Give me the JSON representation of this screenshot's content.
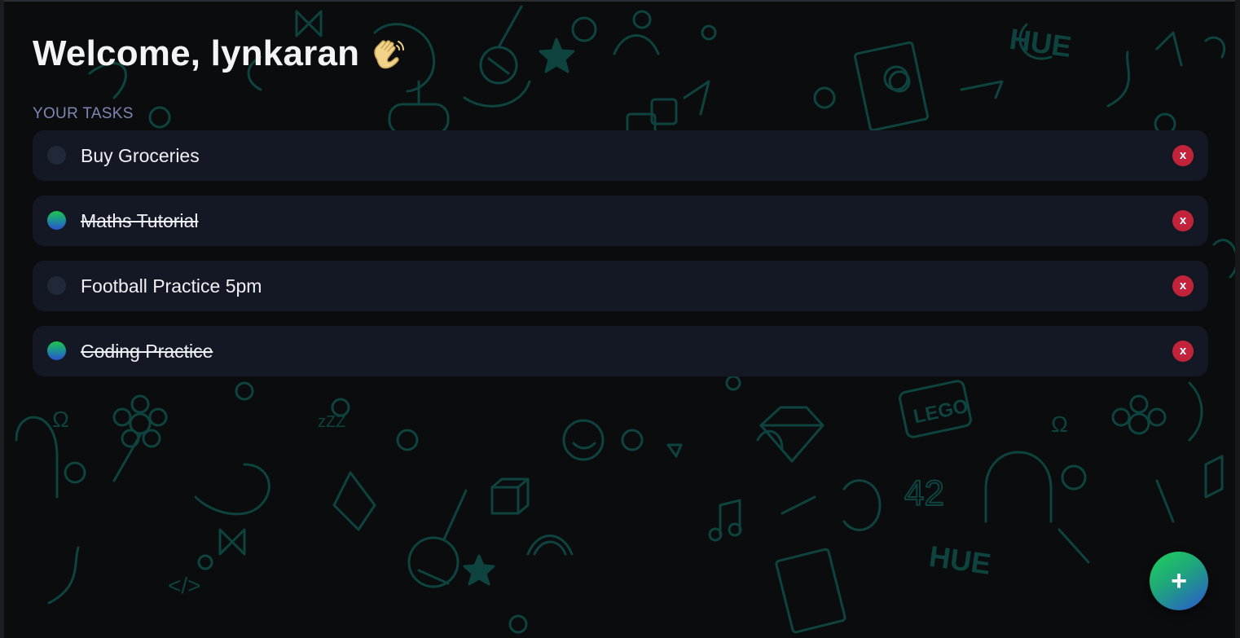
{
  "header": {
    "welcome_text": "Welcome, lynkaran",
    "wave_emoji": "wave-hand-icon"
  },
  "section": {
    "title": "YOUR TASKS"
  },
  "tasks": [
    {
      "label": "Buy Groceries",
      "done": false,
      "delete_label": "x"
    },
    {
      "label": "Maths Tutorial",
      "done": true,
      "delete_label": "x"
    },
    {
      "label": "Football Practice 5pm",
      "done": false,
      "delete_label": "x"
    },
    {
      "label": "Coding Practice",
      "done": true,
      "delete_label": "x"
    }
  ],
  "fab": {
    "label": "+"
  },
  "colors": {
    "background": "#0b0c0e",
    "card": "#131824",
    "doodle": "#0f4a46",
    "accent_green": "#1fd25a",
    "accent_blue": "#2b55d3",
    "delete": "#c3233a",
    "section_label": "#7f86b3"
  }
}
